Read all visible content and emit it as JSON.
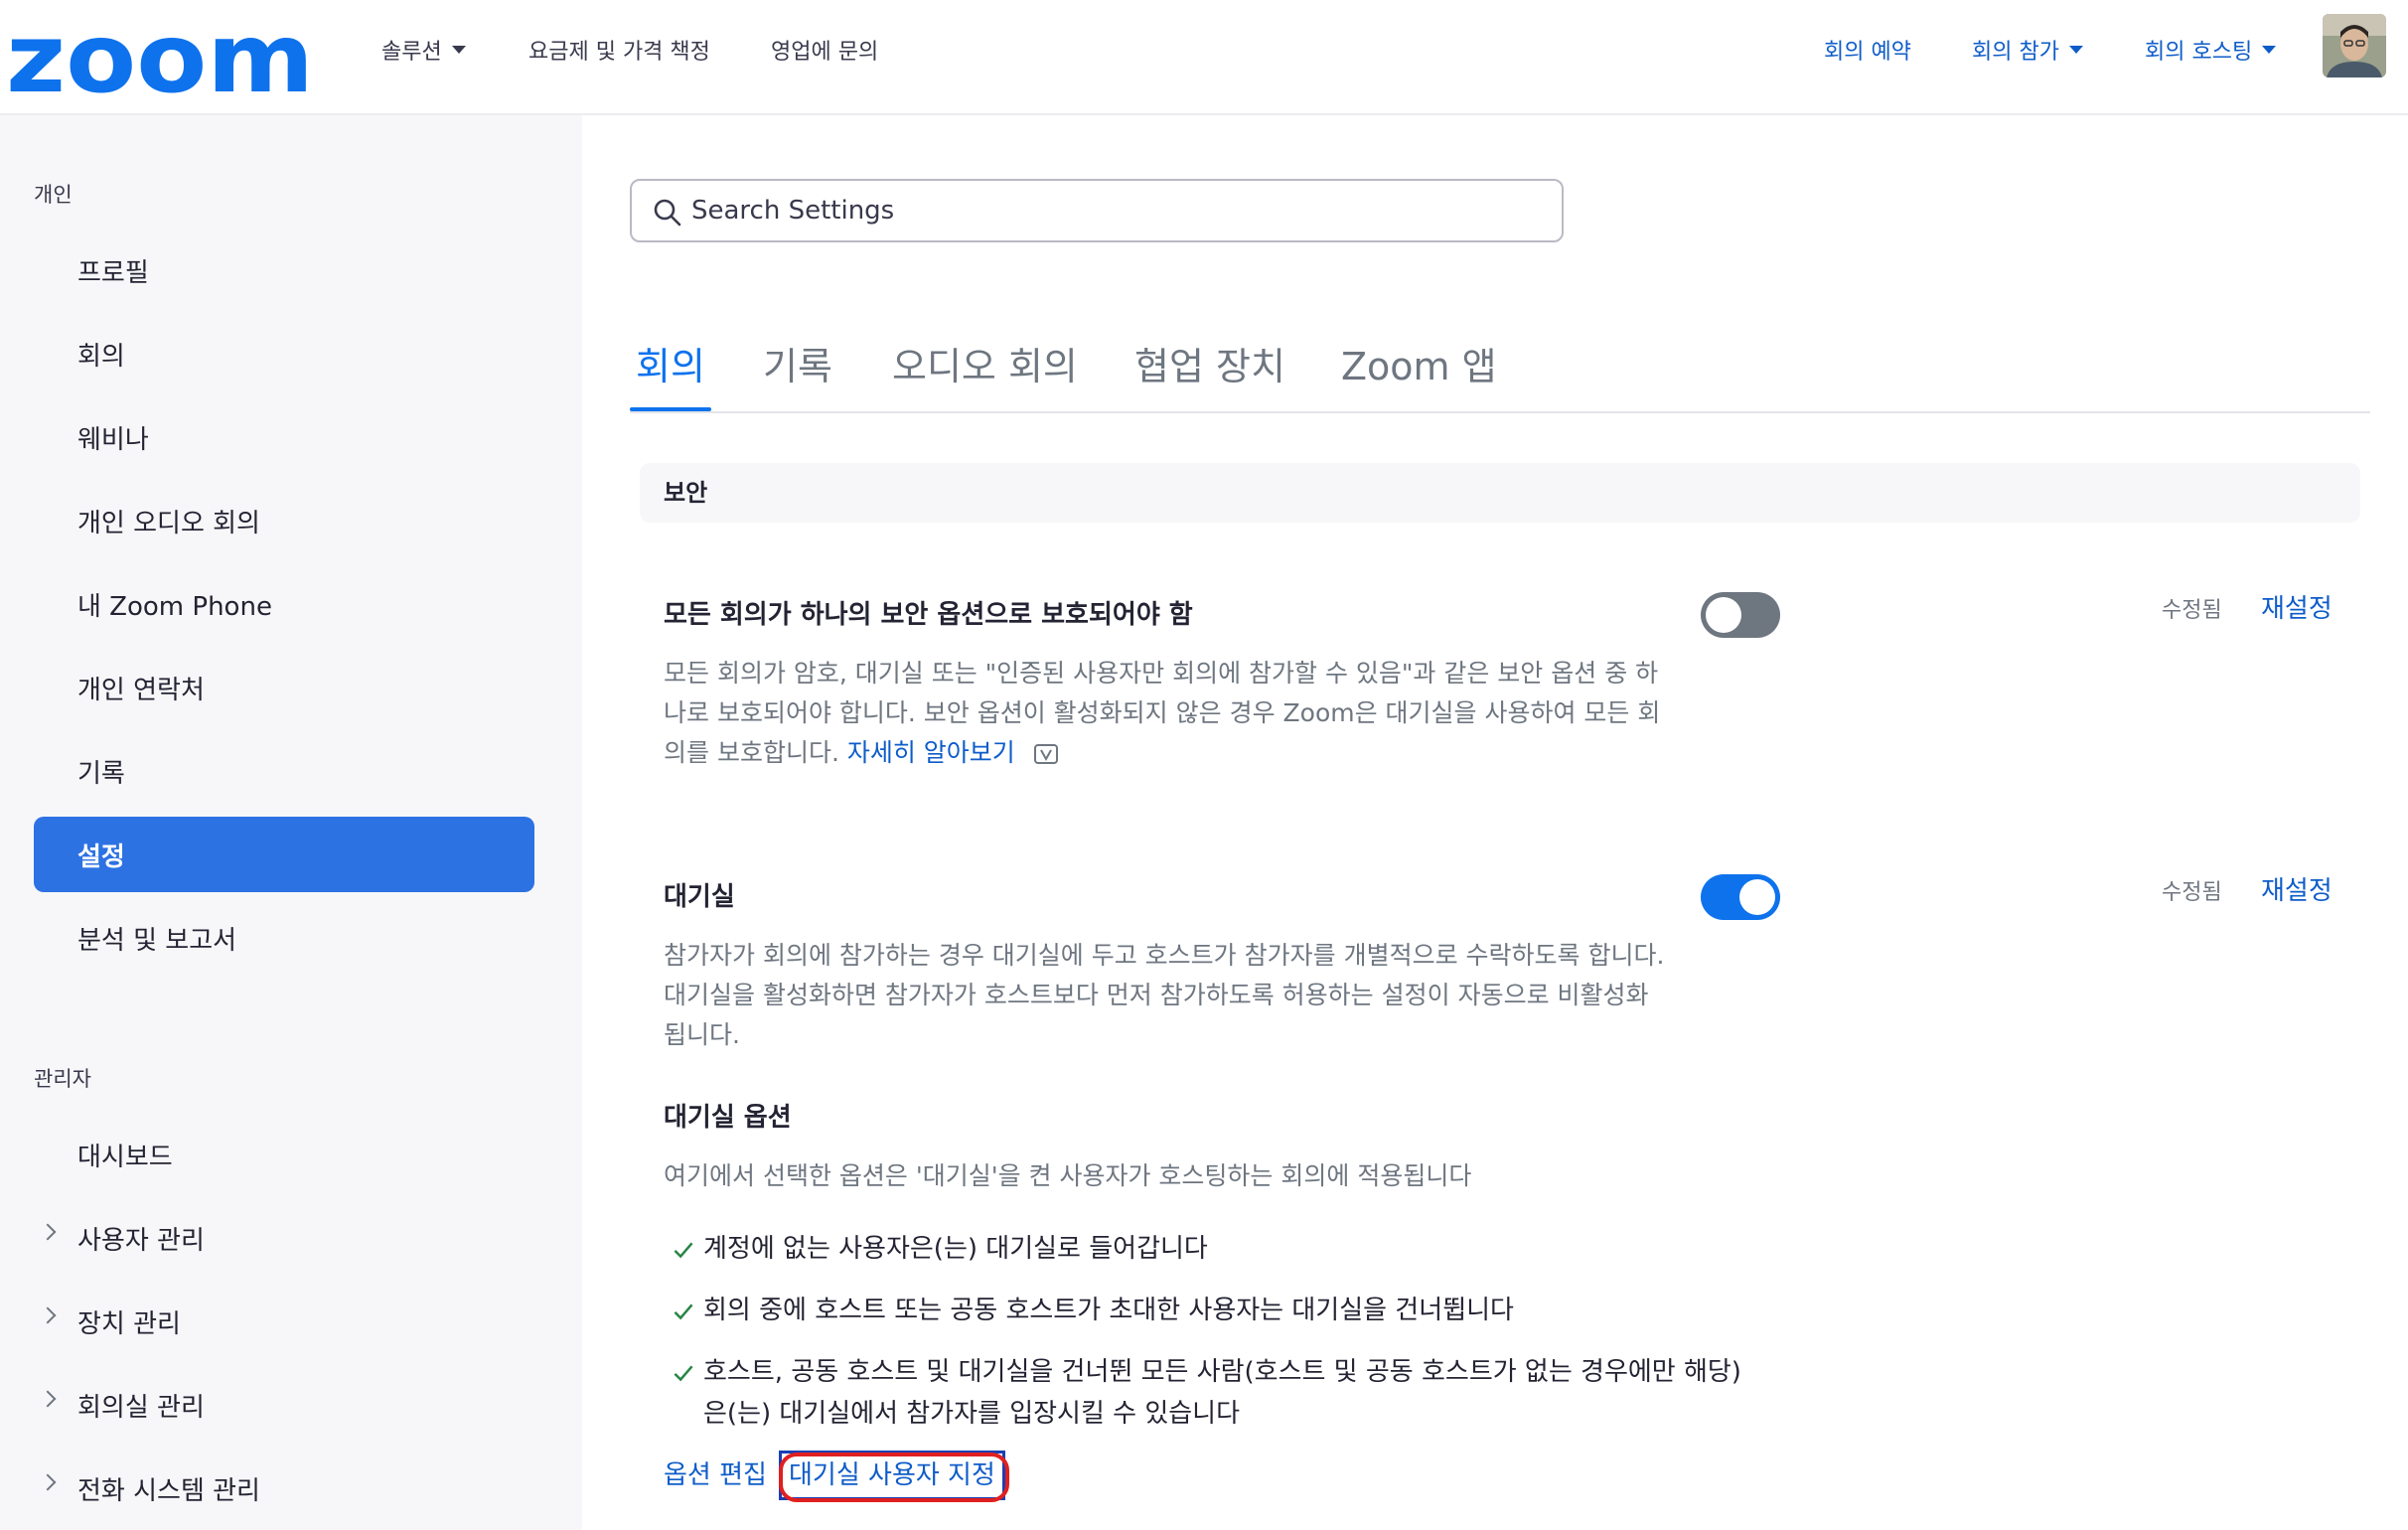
{
  "topbar": {
    "logo_text": "zoom",
    "nav": [
      {
        "label": "솔루션",
        "has_dropdown": true
      },
      {
        "label": "요금제 및 가격 책정",
        "has_dropdown": false
      },
      {
        "label": "영업에 문의",
        "has_dropdown": false
      }
    ],
    "right": [
      {
        "label": "회의 예약",
        "has_dropdown": false
      },
      {
        "label": "회의 참가",
        "has_dropdown": true
      },
      {
        "label": "회의 호스팅",
        "has_dropdown": true
      }
    ],
    "avatar_icon": "user-avatar-photo"
  },
  "sidebar": {
    "personal_heading": "개인",
    "personal_items": [
      "프로필",
      "회의",
      "웨비나",
      "개인 오디오 회의",
      "내 Zoom Phone",
      "개인 연락처",
      "기록",
      "설정",
      "분석 및 보고서"
    ],
    "active_item": "설정",
    "admin_heading": "관리자",
    "admin_items": [
      "대시보드",
      "사용자 관리",
      "장치 관리",
      "회의실 관리",
      "전화 시스템 관리"
    ]
  },
  "search": {
    "placeholder": "Search Settings",
    "icon": "search-icon"
  },
  "tabs": [
    {
      "label": "회의",
      "active": true
    },
    {
      "label": "기록",
      "active": false
    },
    {
      "label": "오디오 회의",
      "active": false
    },
    {
      "label": "협업 장치",
      "active": false
    },
    {
      "label": "Zoom 앱",
      "active": false
    }
  ],
  "section": {
    "title": "보안"
  },
  "settings": [
    {
      "title": "모든 회의가 하나의 보안 옵션으로 보호되어야 함",
      "description": "모든 회의가 암호, 대기실 또는 \"인증된 사용자만 회의에 참가할 수 있음\"과 같은 보안 옵션 중 하나로 보호되어야 합니다. 보안 옵션이 활성화되지 않은 경우 Zoom은 대기실을 사용하여 모든 회의를 보호합니다.",
      "learn_more": "자세히 알아보기",
      "enabled": false,
      "modified_label": "수정됨",
      "reset_label": "재설정"
    },
    {
      "title": "대기실",
      "description": "참가자가 회의에 참가하는 경우 대기실에 두고 호스트가 참가자를 개별적으로 수락하도록 합니다. 대기실을 활성화하면 참가자가 호스트보다 먼저 참가하도록 허용하는 설정이 자동으로 비활성화됩니다.",
      "enabled": true,
      "modified_label": "수정됨",
      "reset_label": "재설정"
    }
  ],
  "waiting_room_options": {
    "title": "대기실 옵션",
    "description": "여기에서 선택한 옵션은 '대기실'을 켠 사용자가 호스팅하는 회의에 적용됩니다",
    "items": [
      "계정에 없는 사용자은(는) 대기실로 들어갑니다",
      "회의 중에 호스트 또는 공동 호스트가 초대한 사용자는 대기실을 건너뜁니다",
      "호스트, 공동 호스트 및 대기실을 건너뛴 모든 사람(호스트 및 공동 호스트가 없는 경우에만 해당)은(는) 대기실에서 참가자를 입장시킬 수 있습니다"
    ],
    "edit_options_label": "옵션 편집",
    "customize_label": "대기실 사용자 지정"
  },
  "colors": {
    "brand_blue": "#0e72ed",
    "link_blue": "#0e5cc9",
    "sidebar_active": "#2d72e3",
    "highlight_red": "#e02020"
  }
}
